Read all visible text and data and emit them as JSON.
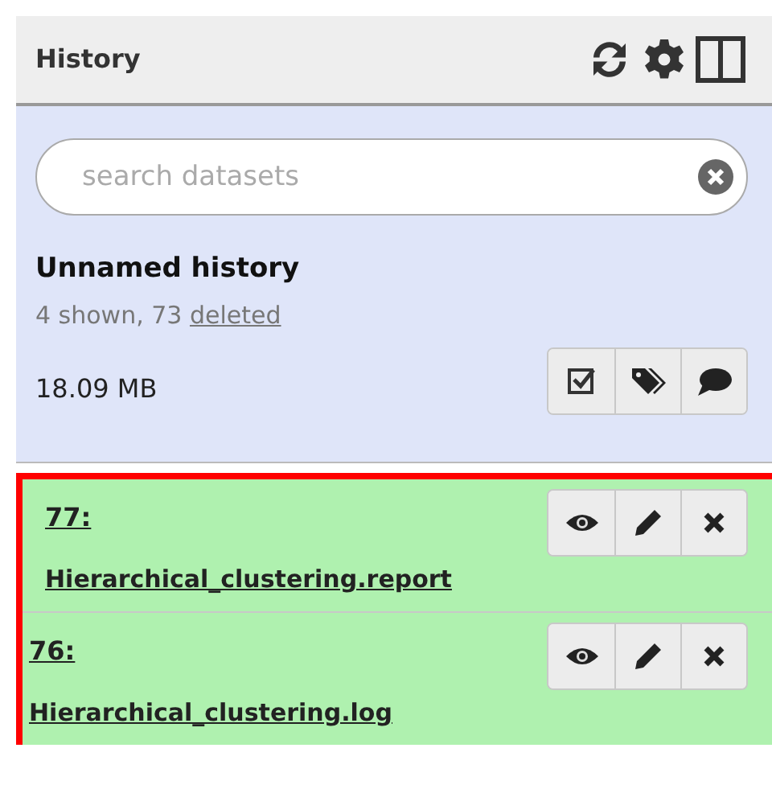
{
  "panel": {
    "title": "History"
  },
  "search": {
    "placeholder": "search datasets"
  },
  "history": {
    "name": "Unnamed history",
    "shown": "4 shown, 73 ",
    "deleted_link": "deleted",
    "size": "18.09 MB"
  },
  "datasets_highlighted": true,
  "datasets": [
    {
      "hid": "77:",
      "name": "Hierarchical_clustering.report"
    },
    {
      "hid": "76:",
      "name": "Hierarchical_clustering.log"
    }
  ]
}
